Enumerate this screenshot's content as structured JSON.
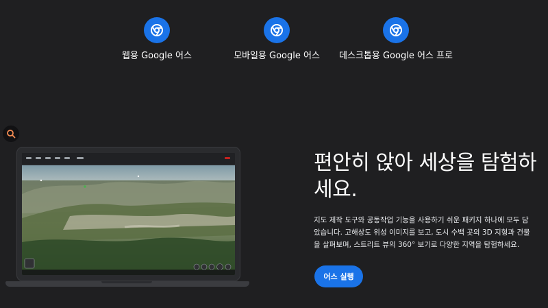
{
  "products": [
    {
      "label": "웹용 Google 어스",
      "icon": "chrome-icon"
    },
    {
      "label": "모바일용 Google 어스",
      "icon": "chrome-icon"
    },
    {
      "label": "데스크톱용 Google 어스 프로",
      "icon": "chrome-icon"
    }
  ],
  "search": {
    "icon": "search-icon"
  },
  "hero": {
    "title": "편안히 앉아 세상을 탐험하세요.",
    "description": "지도 제작 도구와 공동작업 기능을 사용하기 쉬운 패키지 하나에 모두 담았습니다. 고해상도 위성 이미지를 보고, 도시 수백 곳의 3D 지형과 건물을 살펴보며, 스트리트 뷰의 360° 보기로 다양한 지역을 탐험하세요.",
    "cta_label": "어스 실행"
  },
  "colors": {
    "background": "#1f1f21",
    "accent": "#1a73e8",
    "text": "#ffffff"
  }
}
